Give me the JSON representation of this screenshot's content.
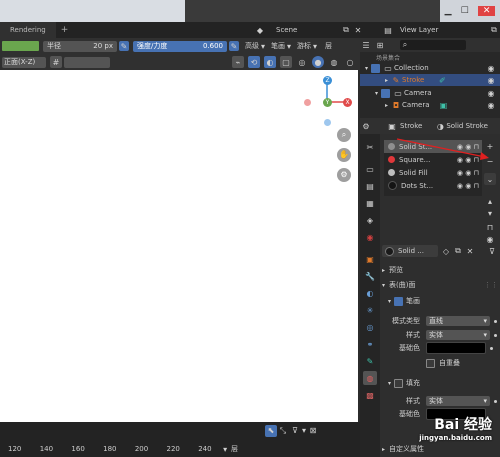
{
  "titlebar": {
    "tab_rendering": "Rendering",
    "tab_add": "+"
  },
  "scene": {
    "label": "Scene",
    "view_layer": "View Layer"
  },
  "tool_header": {
    "radius_label": "半径",
    "radius_value": "20 px",
    "strength_label": "强度/力度",
    "strength_value": "0.600",
    "menu_advanced": "高级",
    "menu_stroke": "笔画",
    "menu_cursor": "游标",
    "menu_layer": "层"
  },
  "viewport": {
    "view_orient": "正面(X-Z)",
    "hash": "#",
    "gizmo": {
      "z": "Z",
      "y": "Y",
      "x": "X"
    }
  },
  "outliner": {
    "header_text": "场景集合",
    "collection": "Collection",
    "stroke": "Stroke",
    "camera_group": "Camera",
    "camera_obj": "Camera"
  },
  "properties": {
    "object_label": "Stroke",
    "mode_label": "Solid Stroke",
    "materials": [
      {
        "name": "Solid St...",
        "color": "#8f8f8f",
        "selected": true
      },
      {
        "name": "Square...",
        "color": "#e0373a",
        "selected": false
      },
      {
        "name": "Solid Fill",
        "color": "#bdbdbd",
        "selected": false
      },
      {
        "name": "Dots St...",
        "color": "#141414",
        "selected": false
      }
    ],
    "slot_name": "Solid ...",
    "preview": "预览",
    "surface": "表(曲)面",
    "stroke_section": "笔画",
    "mode_type_label": "模式类型",
    "mode_type_value": "直线",
    "style_label": "样式",
    "style_value": "实体",
    "base_color_label": "基础色",
    "self_overlap": "自重叠",
    "fill_section": "填充",
    "fill_style_label": "样式",
    "fill_style_value": "实体",
    "fill_base_color_label": "基础色",
    "custom_props": "自定义属性"
  },
  "timeline": {
    "ticks": [
      "120",
      "140",
      "160",
      "180",
      "200",
      "220",
      "240"
    ],
    "layer": "层"
  },
  "watermark": {
    "line1": "Bai 经验",
    "line2": "jingyan.baidu.com"
  },
  "colors": {
    "accent": "#4772b3",
    "green": "#6aa64e",
    "axis_x": "#e04a4a",
    "axis_y": "#6aa64e",
    "axis_z": "#3a8fd6",
    "orange": "#e07a2b"
  }
}
